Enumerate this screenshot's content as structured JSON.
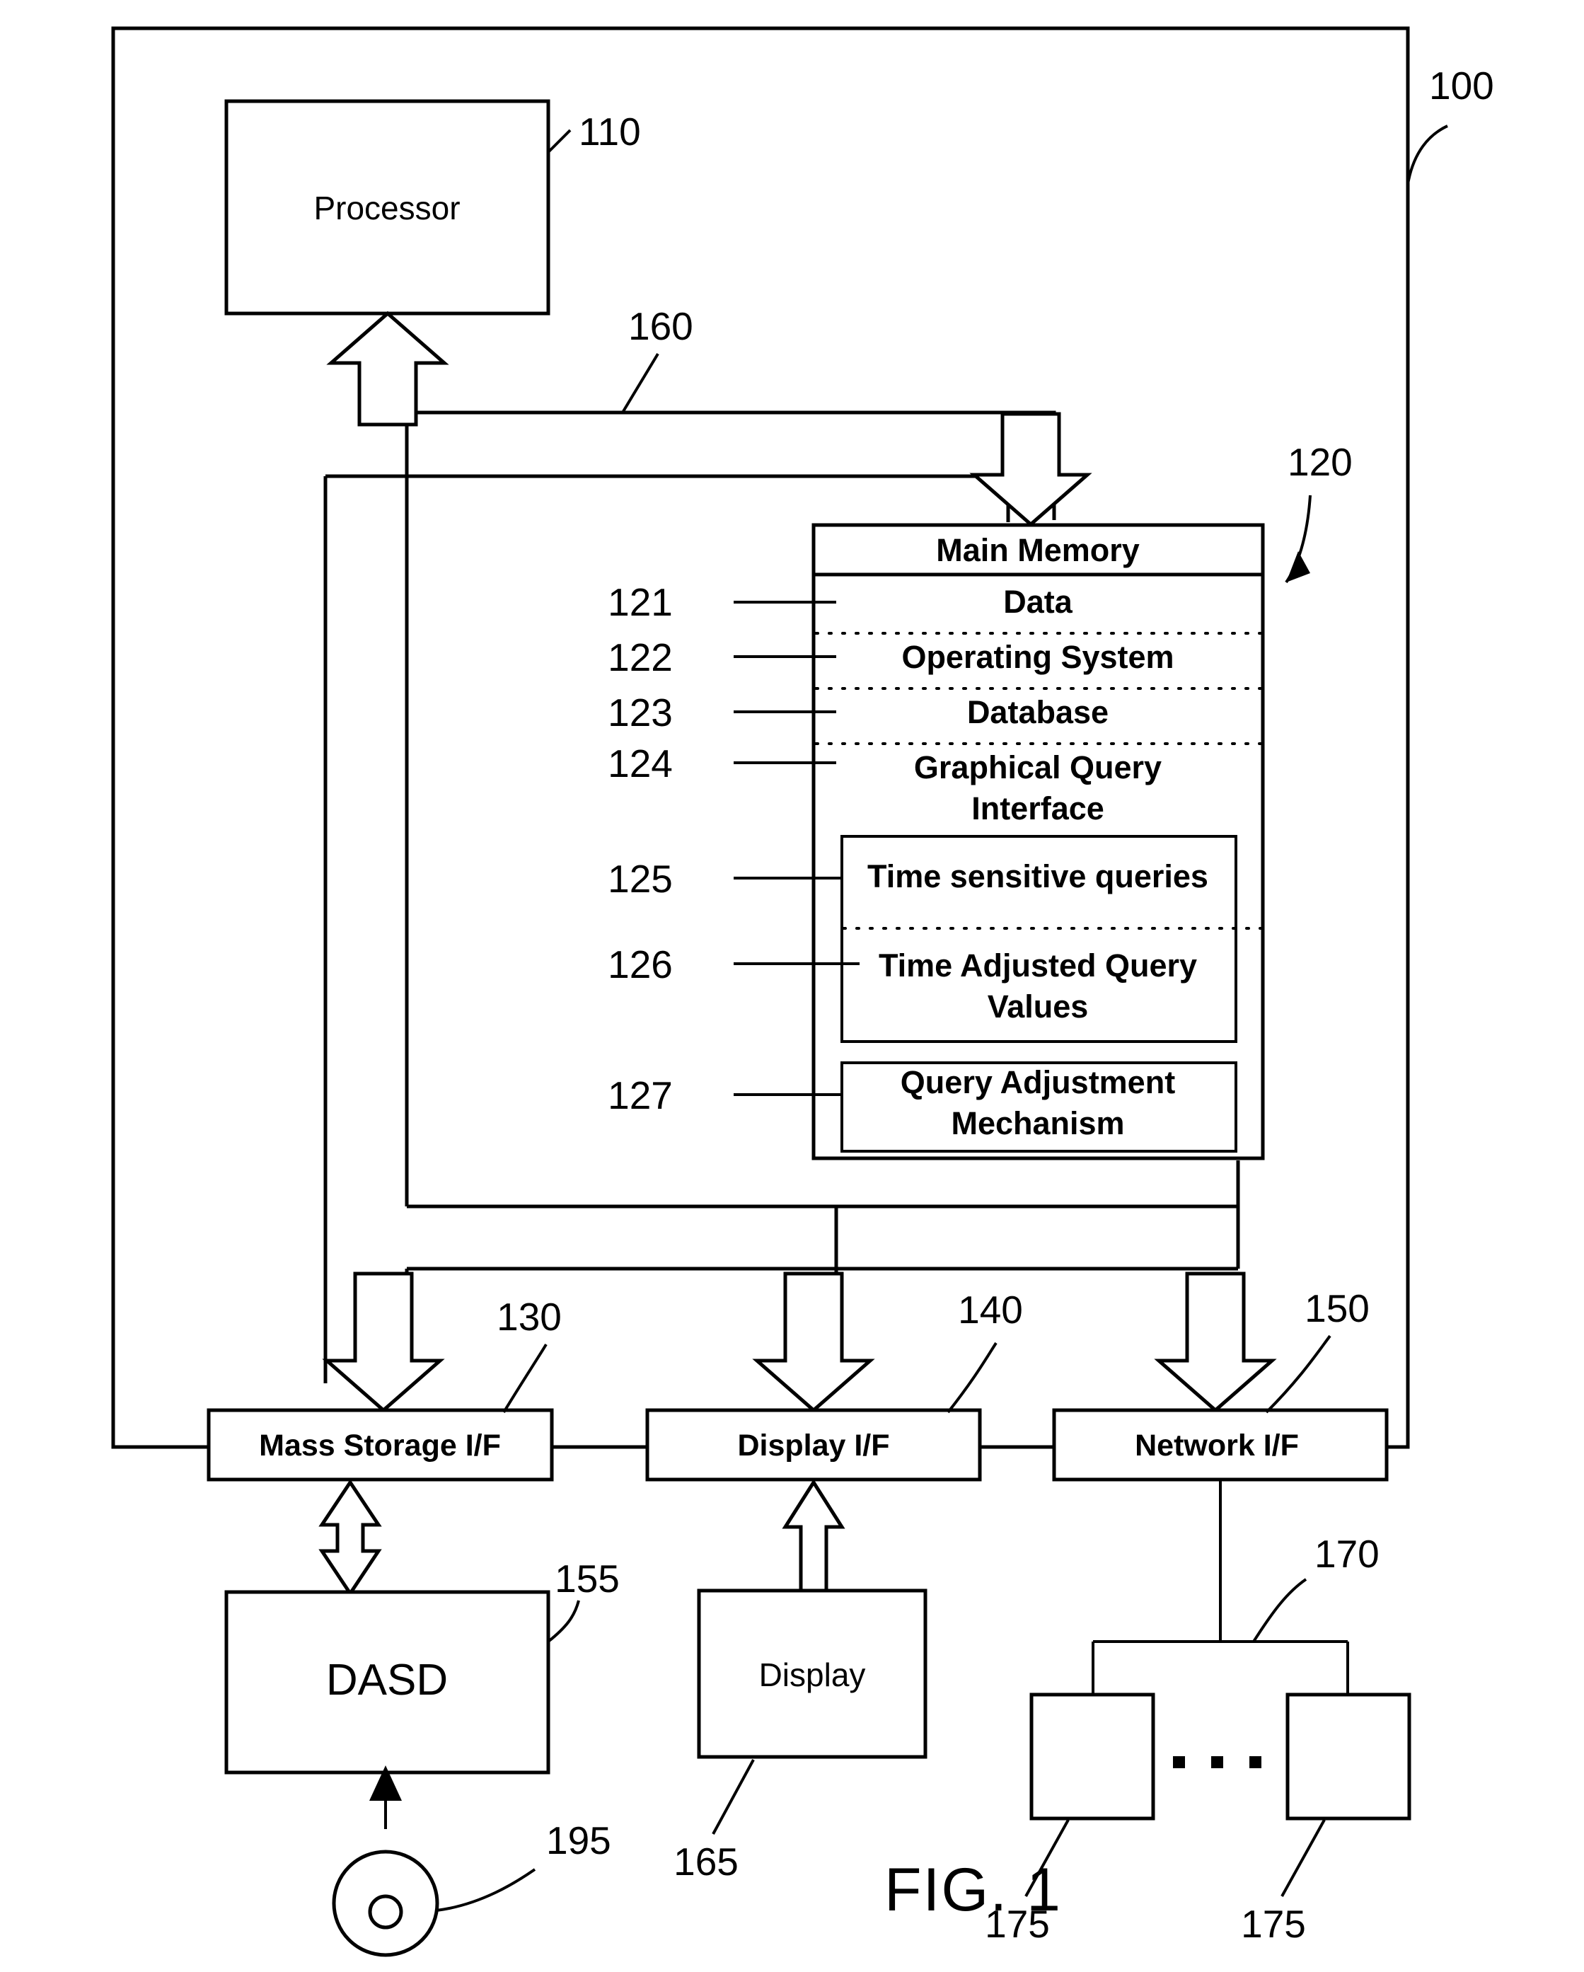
{
  "figure": {
    "caption": "FIG. 1",
    "system_ref": "100"
  },
  "blocks": {
    "processor": {
      "label": "Processor",
      "ref": "110"
    },
    "main_memory": {
      "label": "Main Memory",
      "ref": "120"
    },
    "mass_storage_if": {
      "label": "Mass Storage I/F",
      "ref": "130"
    },
    "display_if": {
      "label": "Display I/F",
      "ref": "140"
    },
    "network_if": {
      "label": "Network I/F",
      "ref": "150"
    },
    "dasd": {
      "label": "DASD",
      "ref": "155"
    },
    "display": {
      "label": "Display",
      "ref": "165"
    },
    "bus": {
      "ref": "160"
    },
    "network": {
      "ref": "170"
    },
    "removable_media": {
      "ref": "195"
    }
  },
  "memory_items": [
    {
      "ref": "121",
      "label": "Data"
    },
    {
      "ref": "122",
      "label": "Operating System"
    },
    {
      "ref": "123",
      "label": "Database"
    },
    {
      "ref": "124",
      "label": "Graphical Query Interface",
      "line1": "Graphical Query",
      "line2": "Interface"
    },
    {
      "ref": "125",
      "label": "Time sensitive queries"
    },
    {
      "ref": "126",
      "label": "Time Adjusted Query Values",
      "line1": "Time Adjusted Query",
      "line2": "Values"
    },
    {
      "ref": "127",
      "label": "Query Adjustment Mechanism",
      "line1": "Query Adjustment",
      "line2": "Mechanism"
    }
  ],
  "network_nodes": [
    {
      "ref": "175"
    },
    {
      "ref": "175"
    }
  ],
  "ellipsis": "▪ ▪ ▪",
  "colors": {
    "stroke": "#000000",
    "fill": "#ffffff"
  }
}
